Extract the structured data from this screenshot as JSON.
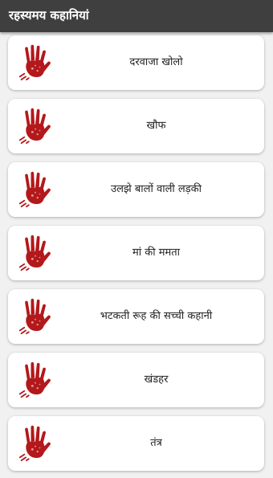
{
  "appbar": {
    "title": "रहस्यमय कहानियां",
    "background": "#3f3f3f"
  },
  "stories": {
    "icon": "bloody-hand-icon",
    "accent": "#b3181b",
    "items": [
      {
        "label": "दरवाजा खोलो"
      },
      {
        "label": "खौफ"
      },
      {
        "label": "उलझे बालों वाली लड़की"
      },
      {
        "label": "मां की ममता"
      },
      {
        "label": "भटकती रूह की सच्ची कहानी"
      },
      {
        "label": "खंडहर"
      },
      {
        "label": "तंत्र"
      }
    ]
  }
}
